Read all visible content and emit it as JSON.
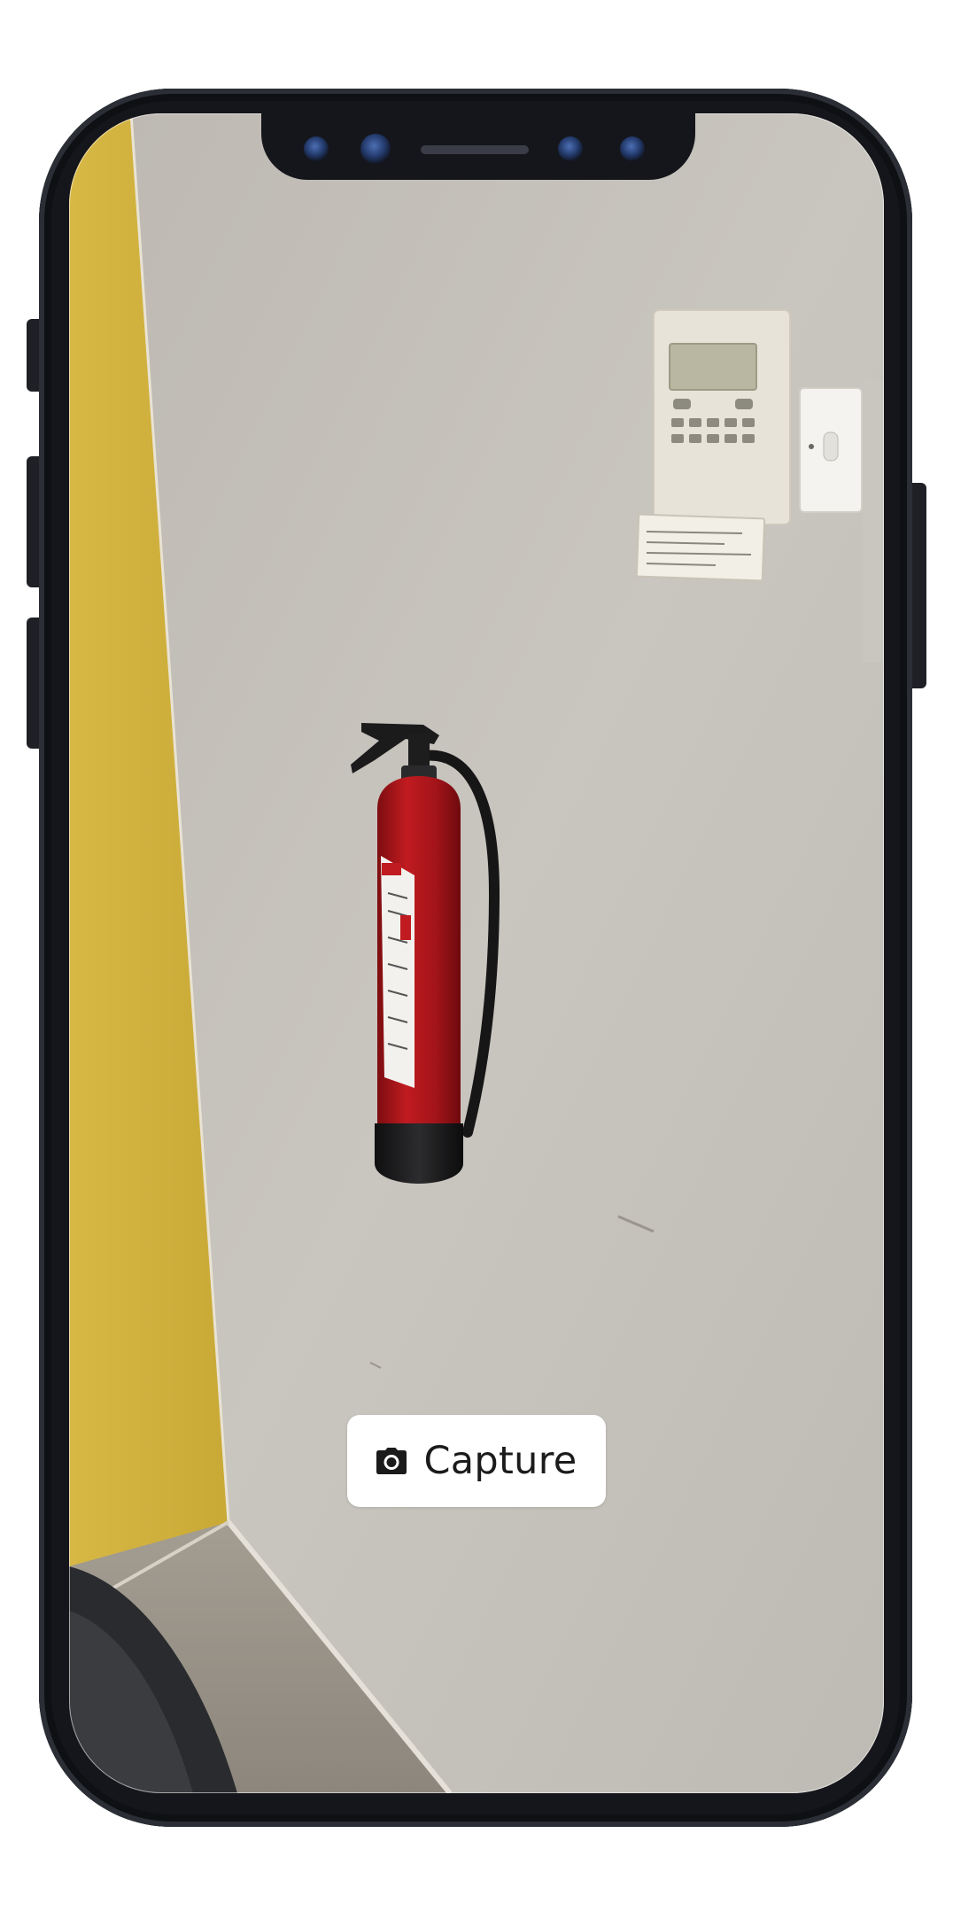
{
  "app": {
    "capture_label": "Capture",
    "capture_icon": "camera-icon"
  },
  "scene": {
    "object": "fire-extinguisher",
    "wall_color": "#c6c2bc",
    "accent_wall_color": "#d6b640",
    "floor_color": "#9b958a",
    "extinguisher_color": "#b3161c"
  },
  "device": {
    "frame_color": "#15161b"
  }
}
